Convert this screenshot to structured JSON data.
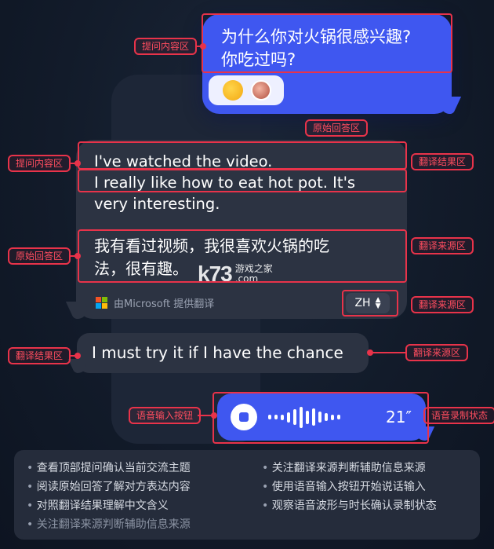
{
  "question": {
    "line1": "为什么你对火锅很感兴趣?",
    "line2": "你吃过吗?",
    "reactions": [
      "emoji-hand-icon",
      "avatar-pair-icon"
    ]
  },
  "reply": {
    "en_line1": "I've watched the video.",
    "en_line2": "I really like how to eat hot pot. It's",
    "en_line3": "very interesting.",
    "zh_line1": "我有看过视频，我很喜欢火锅的吃",
    "zh_line2": "法，很有趣。",
    "provider": "由Microsoft 提供翻译",
    "lang": "ZH",
    "ms_colors": [
      "#f35325",
      "#81bc06",
      "#05a6f0",
      "#ffba08"
    ]
  },
  "second_reply": {
    "text": "I must try it if I have the chance"
  },
  "voice": {
    "timer": "21″",
    "wave_levels": [
      0.2,
      0.2,
      0.25,
      0.45,
      0.7,
      0.95,
      0.6,
      0.8,
      0.5,
      0.35,
      0.25,
      0.2
    ]
  },
  "watermark": {
    "logo": "k73",
    "site_name": "游戏之家",
    "site_domain": ".com"
  },
  "annotations": {
    "ask_area_top": "提问内容区",
    "original_area_top": "原始回答区",
    "ask_area_left": "提问内容区",
    "result_area_right": "翻译结果区",
    "original_area_left": "原始回答区",
    "source_area_right_1": "翻译来源区",
    "source_area_right_2": "翻译来源区",
    "result_area_left": "翻译结果区",
    "source_area_right_3": "翻译来源区",
    "voice_input_button": "语音输入按钮",
    "voice_record_state": "语音录制状态"
  },
  "notes": {
    "left": [
      "查看顶部提问确认当前交流主题",
      "阅读原始回答了解对方表达内容",
      "对照翻译结果理解中文含义",
      "关注翻译来源判断辅助信息来源"
    ],
    "right": [
      "关注翻译来源判断辅助信息来源",
      "使用语音输入按钮开始说话输入",
      "观察语音波形与时长确认录制状态"
    ]
  },
  "colors": {
    "accent_blue": "#3f57f0",
    "annotation_red": "#e8334a",
    "bubble_gray": "#2c3342"
  }
}
